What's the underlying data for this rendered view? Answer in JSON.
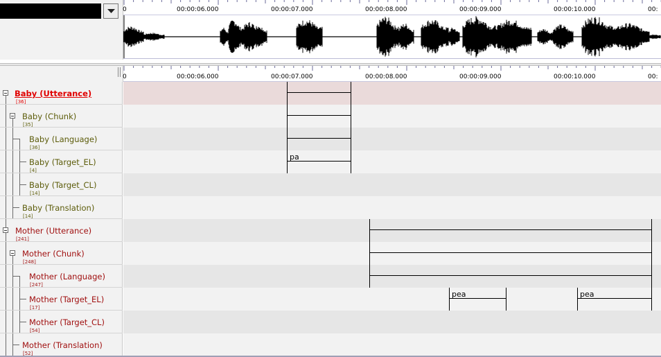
{
  "selector": {
    "value": "",
    "dropdown_icon": "chevron-down-icon"
  },
  "ruler": {
    "ticks": [
      "00:00:06.000",
      "00:00:07.000",
      "00:00:08.000",
      "00:00:09.000",
      "00:00:10.000"
    ],
    "edge_left": "0",
    "edge_right": "00:"
  },
  "tiers": [
    {
      "name": "Baby (Utterance)",
      "count": "[36]",
      "style": "active"
    },
    {
      "name": "Baby (Chunk)",
      "count": "[35]",
      "style": "olive"
    },
    {
      "name": "Baby (Language)",
      "count": "[36]",
      "style": "olive"
    },
    {
      "name": "Baby (Target_EL)",
      "count": "[4]",
      "style": "olive"
    },
    {
      "name": "Baby (Target_CL)",
      "count": "[14]",
      "style": "olive"
    },
    {
      "name": "Baby (Translation)",
      "count": "[14]",
      "style": "olive"
    },
    {
      "name": "Mother (Utterance)",
      "count": "[241]",
      "style": "red"
    },
    {
      "name": "Mother (Chunk)",
      "count": "[248]",
      "style": "red"
    },
    {
      "name": "Mother (Language)",
      "count": "[247]",
      "style": "red"
    },
    {
      "name": "Mother (Target_EL)",
      "count": "[17]",
      "style": "red"
    },
    {
      "name": "Mother (Target_CL)",
      "count": "[54]",
      "style": "red"
    },
    {
      "name": "Mother (Translation)",
      "count": "[52]",
      "style": "red"
    }
  ],
  "annotations": {
    "baby_target_el": "pa",
    "mother_target_el_1": "pea",
    "mother_target_el_2": "pea"
  },
  "colors": {
    "active_tier": "#e00000",
    "baby_tier": "#5c5c0a",
    "mother_tier": "#a01010",
    "active_row": "#eadada"
  }
}
